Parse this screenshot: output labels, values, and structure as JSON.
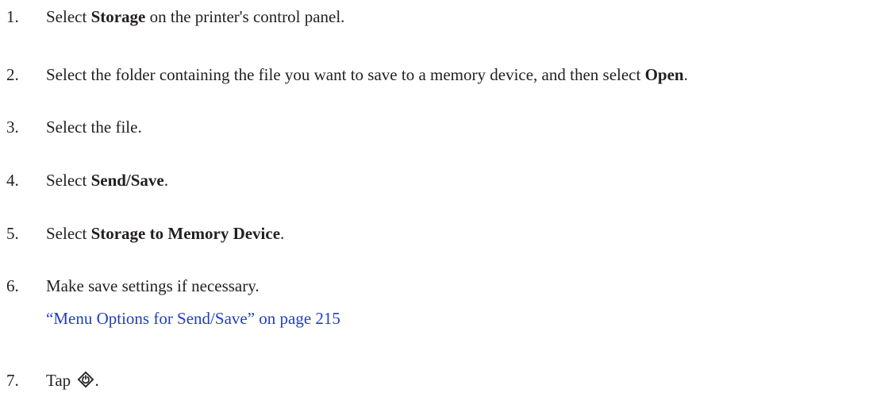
{
  "steps": [
    {
      "number": "1.",
      "pre": "Select ",
      "bold": "Storage",
      "post": " on the printer's control panel."
    },
    {
      "number": "2.",
      "pre": "Select the folder containing the file you want to save to a memory device, and then select ",
      "bold": "Open",
      "post": "."
    },
    {
      "number": "3.",
      "text": "Select the file."
    },
    {
      "number": "4.",
      "pre": "Select ",
      "bold": "Send/Save",
      "post": "."
    },
    {
      "number": "5.",
      "pre": "Select ",
      "bold": "Storage to Memory Device",
      "post": "."
    },
    {
      "number": "6.",
      "text": "Make save settings if necessary.",
      "link": "“Menu Options for Send/Save” on page 215"
    },
    {
      "number": "7.",
      "pre": "Tap ",
      "icon": "start-button-icon",
      "post": "."
    }
  ]
}
